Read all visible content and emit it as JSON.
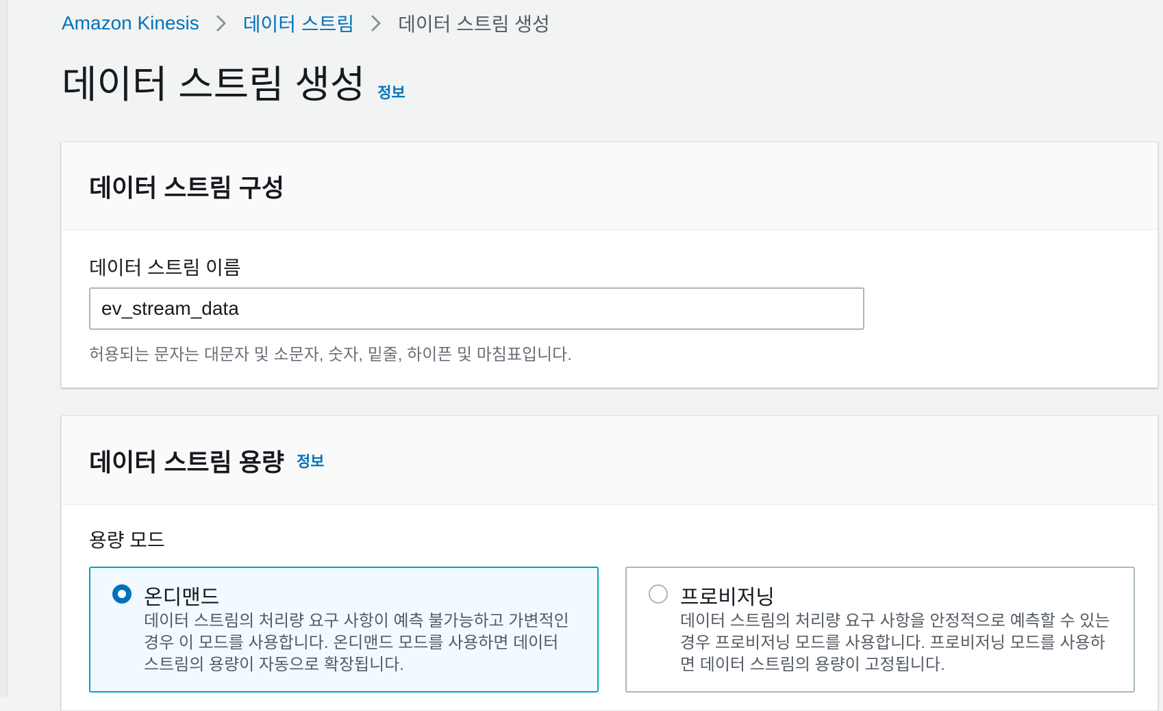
{
  "breadcrumb": {
    "items": [
      {
        "label": "Amazon Kinesis"
      },
      {
        "label": "데이터 스트림"
      },
      {
        "label": "데이터 스트림 생성"
      }
    ]
  },
  "page": {
    "title": "데이터 스트림 생성",
    "info_label": "정보"
  },
  "config_panel": {
    "heading": "데이터 스트림 구성",
    "name_field": {
      "label": "데이터 스트림 이름",
      "value": "ev_stream_data",
      "hint": "허용되는 문자는 대문자 및 소문자, 숫자, 밑줄, 하이픈 및 마침표입니다."
    }
  },
  "capacity_panel": {
    "heading": "데이터 스트림 용량",
    "info_label": "정보",
    "mode_label": "용량 모드",
    "options": [
      {
        "title": "온디맨드",
        "description": "데이터 스트림의 처리량 요구 사항이 예측 불가능하고 가변적인 경우 이 모드를 사용합니다. 온디맨드 모드를 사용하면 데이터 스트림의 용량이 자동으로 확장됩니다.",
        "selected": true
      },
      {
        "title": "프로비저닝",
        "description": "데이터 스트림의 처리량 요구 사항을 안정적으로 예측할 수 있는 경우 프로비저닝 모드를 사용합니다. 프로비저닝 모드를 사용하면 데이터 스트림의 용량이 고정됩니다.",
        "selected": false
      }
    ]
  },
  "colors": {
    "link": "#0073bb",
    "selected_border": "#00a1c9",
    "selected_bg": "#f1faff"
  }
}
